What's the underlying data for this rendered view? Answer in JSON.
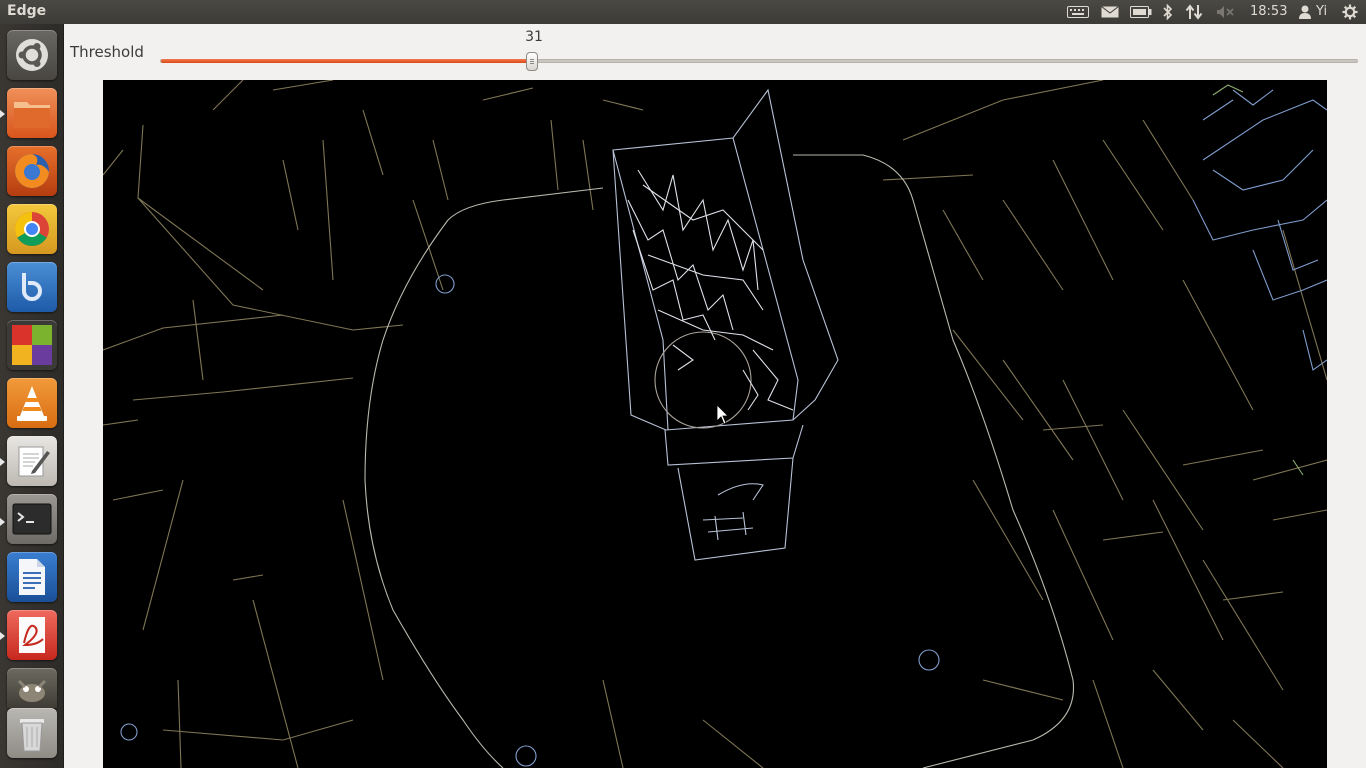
{
  "panel": {
    "app_title": "Edge",
    "clock": "18:53",
    "user": "Yi",
    "tray_icons": [
      "keyboard-icon",
      "mail-icon",
      "battery-icon",
      "bluetooth-icon",
      "network-icon",
      "volume-muted-icon",
      "user-icon",
      "power-gear-icon"
    ]
  },
  "launcher": {
    "items": [
      {
        "name": "dash-home",
        "icon": "ubuntu-logo-icon"
      },
      {
        "name": "files",
        "icon": "folder-icon",
        "running": true
      },
      {
        "name": "firefox",
        "icon": "firefox-icon"
      },
      {
        "name": "chrome",
        "icon": "chrome-icon"
      },
      {
        "name": "bluefish",
        "icon": "bluefish-icon"
      },
      {
        "name": "software-center",
        "icon": "color-squares-icon"
      },
      {
        "name": "vlc",
        "icon": "vlc-cone-icon"
      },
      {
        "name": "text-editor",
        "icon": "text-editor-icon",
        "running": true
      },
      {
        "name": "terminal",
        "icon": "terminal-icon",
        "running": true
      },
      {
        "name": "libreoffice-writer",
        "icon": "writer-document-icon"
      },
      {
        "name": "evince",
        "icon": "pdf-viewer-icon",
        "running": true
      },
      {
        "name": "gimp",
        "icon": "gimp-icon"
      },
      {
        "name": "trash",
        "icon": "trash-icon"
      }
    ]
  },
  "toolbar": {
    "threshold_label": "Threshold",
    "threshold_value": "31",
    "threshold_fraction": 0.31
  },
  "colors": {
    "panel_bg": "#3c3b37",
    "slider_accent": "#dd4814",
    "canvas_bg": "#000000",
    "edge_light": "#d8dce6",
    "edge_blue": "#7f9ccc",
    "edge_olive": "#8a7f57"
  }
}
